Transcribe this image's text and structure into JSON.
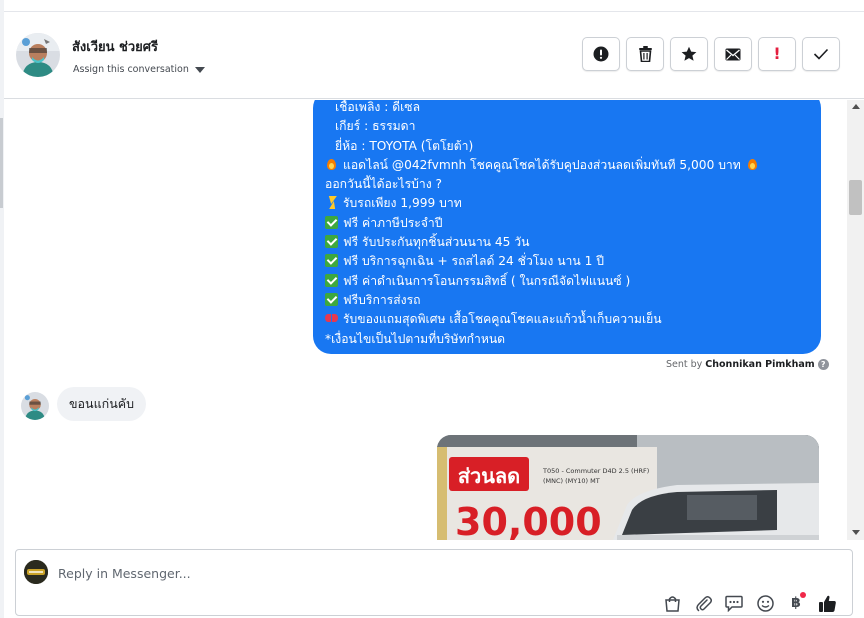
{
  "header": {
    "contact_name": "สังเวียน ช่วยศรี",
    "assign_label": "Assign this conversation"
  },
  "actions": [
    {
      "name": "spam-button",
      "icon": "exclamation-circle-icon"
    },
    {
      "name": "delete-button",
      "icon": "trash-icon"
    },
    {
      "name": "star-button",
      "icon": "star-icon"
    },
    {
      "name": "mark-unread-button",
      "icon": "envelope-icon"
    },
    {
      "name": "follow-up-button",
      "icon": "red-exclamation-icon",
      "glyph": "!"
    },
    {
      "name": "mark-done-button",
      "icon": "checkmark-icon"
    }
  ],
  "outgoing_message": {
    "lines": [
      "เชื้อเพลิง : ดีเซล",
      "เกียร์ : ธรรมดา",
      "ยี่ห้อ : TOYOTA (โตโยต้า)",
      "แอดไลน์ @042fvmnh โชคคูณโชคได้รับคูปองส่วนลดเพิ่มทันที 5,000 บาท",
      "ออกวันนี้ได้อะไรบ้าง ?",
      "รับรถเพียง 1,999 บาท",
      "ฟรี ค่าภาษีประจำปี",
      "ฟรี รับประกันทุกชิ้นส่วนนาน 45 วัน",
      "ฟรี บริการฉุกเฉิน + รถสไลด์ 24 ชั่วโมง นาน 1 ปี",
      "ฟรี ค่าดำเนินการโอนกรรมสิทธิ์ ( ในกรณีจัดไฟแนนซ์ )",
      "ฟรีบริการส่งรถ",
      "รับของแถมสุดพิเศษ เสื้อโชคคูณโชคและแก้วน้ำเก็บความเย็น",
      "*เงื่อนไขเป็นไปตามที่บริษัทกำหนด"
    ],
    "sent_by_prefix": "Sent by",
    "sent_by_name": "Chonnikan Pimkham"
  },
  "incoming_message": {
    "text": "ขอนแก่นคับ"
  },
  "image_message": {
    "discount_text": "ส่วนลด",
    "amount_text": "30,000",
    "model_line1": "T050 - Commuter D4D 2.5 (HRF)",
    "model_line2": "(MNC) (MY10) MT"
  },
  "composer": {
    "placeholder": "Reply in Messenger...",
    "value": "",
    "tools": [
      "shopping-bag-icon",
      "paperclip-icon",
      "saved-replies-icon",
      "emoji-icon",
      "baht-payment-icon",
      "thumbs-up-icon"
    ],
    "baht_glyph": "฿"
  },
  "colors": {
    "bubble_out": "#1877f2",
    "bubble_in": "#f0f2f5",
    "follow_up_red": "#e41e3f",
    "promo_red": "#d81f26"
  }
}
